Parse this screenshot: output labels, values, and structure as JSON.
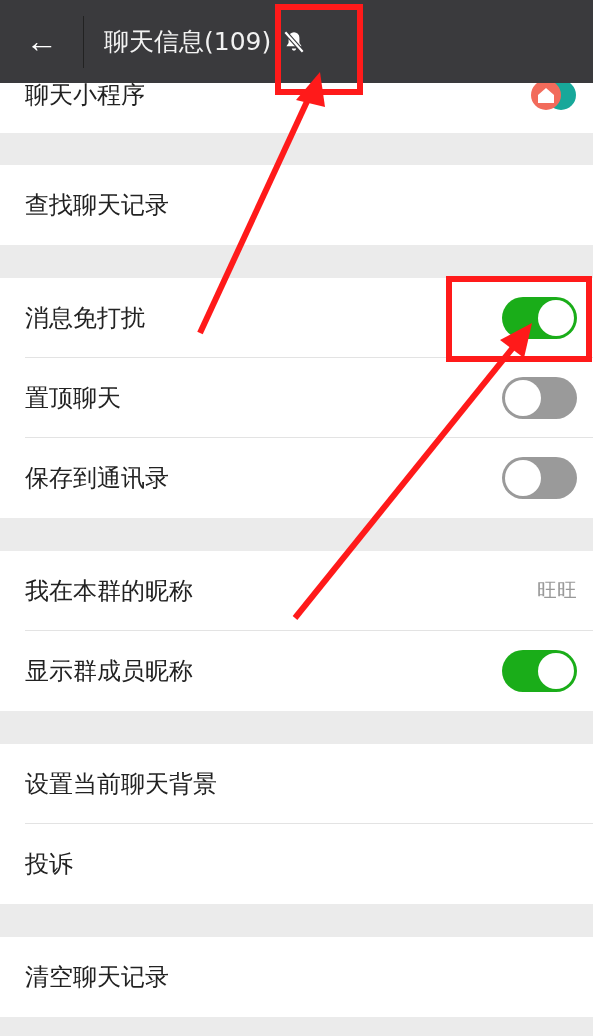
{
  "header": {
    "back": "←",
    "title": "聊天信息(109)",
    "muted": true
  },
  "sections": [
    {
      "rows": [
        {
          "kind": "icon",
          "label": "聊天小程序"
        }
      ]
    },
    {
      "rows": [
        {
          "kind": "plain",
          "label": "查找聊天记录"
        }
      ]
    },
    {
      "rows": [
        {
          "kind": "toggle",
          "label": "消息免打扰",
          "on": true
        },
        {
          "kind": "toggle",
          "label": "置顶聊天",
          "on": false
        },
        {
          "kind": "toggle",
          "label": "保存到通讯录",
          "on": false
        }
      ]
    },
    {
      "rows": [
        {
          "kind": "value",
          "label": "我在本群的昵称",
          "value": "旺旺"
        },
        {
          "kind": "toggle",
          "label": "显示群成员昵称",
          "on": true
        }
      ]
    },
    {
      "rows": [
        {
          "kind": "plain",
          "label": "设置当前聊天背景"
        },
        {
          "kind": "plain",
          "label": "投诉"
        }
      ]
    },
    {
      "rows": [
        {
          "kind": "plain",
          "label": "清空聊天记录"
        }
      ]
    }
  ]
}
